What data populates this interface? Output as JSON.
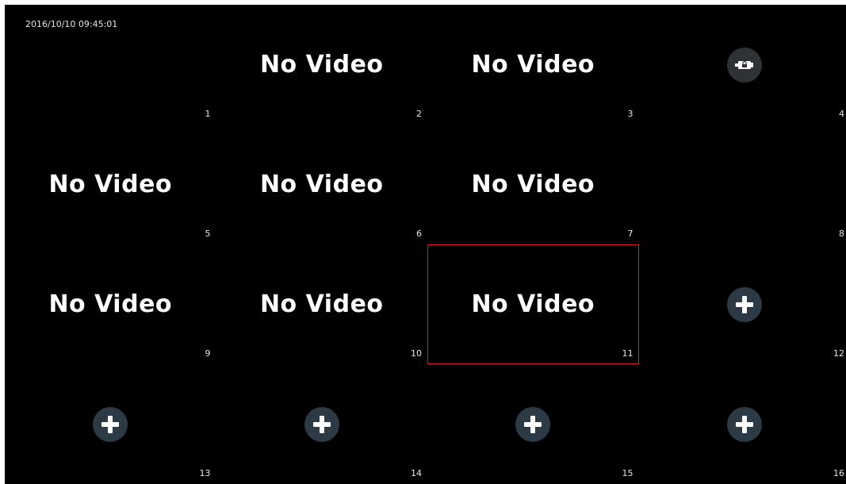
{
  "screen": {
    "background": "#000000",
    "timestamp": "2016/10/10 09:45:01"
  },
  "accent": {
    "selected_border": "#e01b1b",
    "button_bg": "#2c3a46"
  },
  "tiles": [
    {
      "channel": "1",
      "state": "empty",
      "label": ""
    },
    {
      "channel": "2",
      "state": "no-video",
      "label": "No Video"
    },
    {
      "channel": "3",
      "state": "no-video",
      "label": "No Video"
    },
    {
      "channel": "4",
      "state": "locked",
      "label": "",
      "icon": "usb-lock-icon"
    },
    {
      "channel": "5",
      "state": "no-video",
      "label": "No Video"
    },
    {
      "channel": "6",
      "state": "no-video",
      "label": "No Video"
    },
    {
      "channel": "7",
      "state": "no-video",
      "label": "No Video"
    },
    {
      "channel": "8",
      "state": "empty",
      "label": ""
    },
    {
      "channel": "9",
      "state": "no-video",
      "label": "No Video"
    },
    {
      "channel": "10",
      "state": "no-video",
      "label": "No Video"
    },
    {
      "channel": "11",
      "state": "no-video",
      "label": "No Video",
      "selected": true
    },
    {
      "channel": "12",
      "state": "add",
      "label": "",
      "icon": "plus-icon"
    },
    {
      "channel": "13",
      "state": "add",
      "label": "",
      "icon": "plus-icon"
    },
    {
      "channel": "14",
      "state": "add",
      "label": "",
      "icon": "plus-icon"
    },
    {
      "channel": "15",
      "state": "add",
      "label": "",
      "icon": "plus-icon"
    },
    {
      "channel": "16",
      "state": "add",
      "label": "",
      "icon": "plus-icon"
    }
  ]
}
